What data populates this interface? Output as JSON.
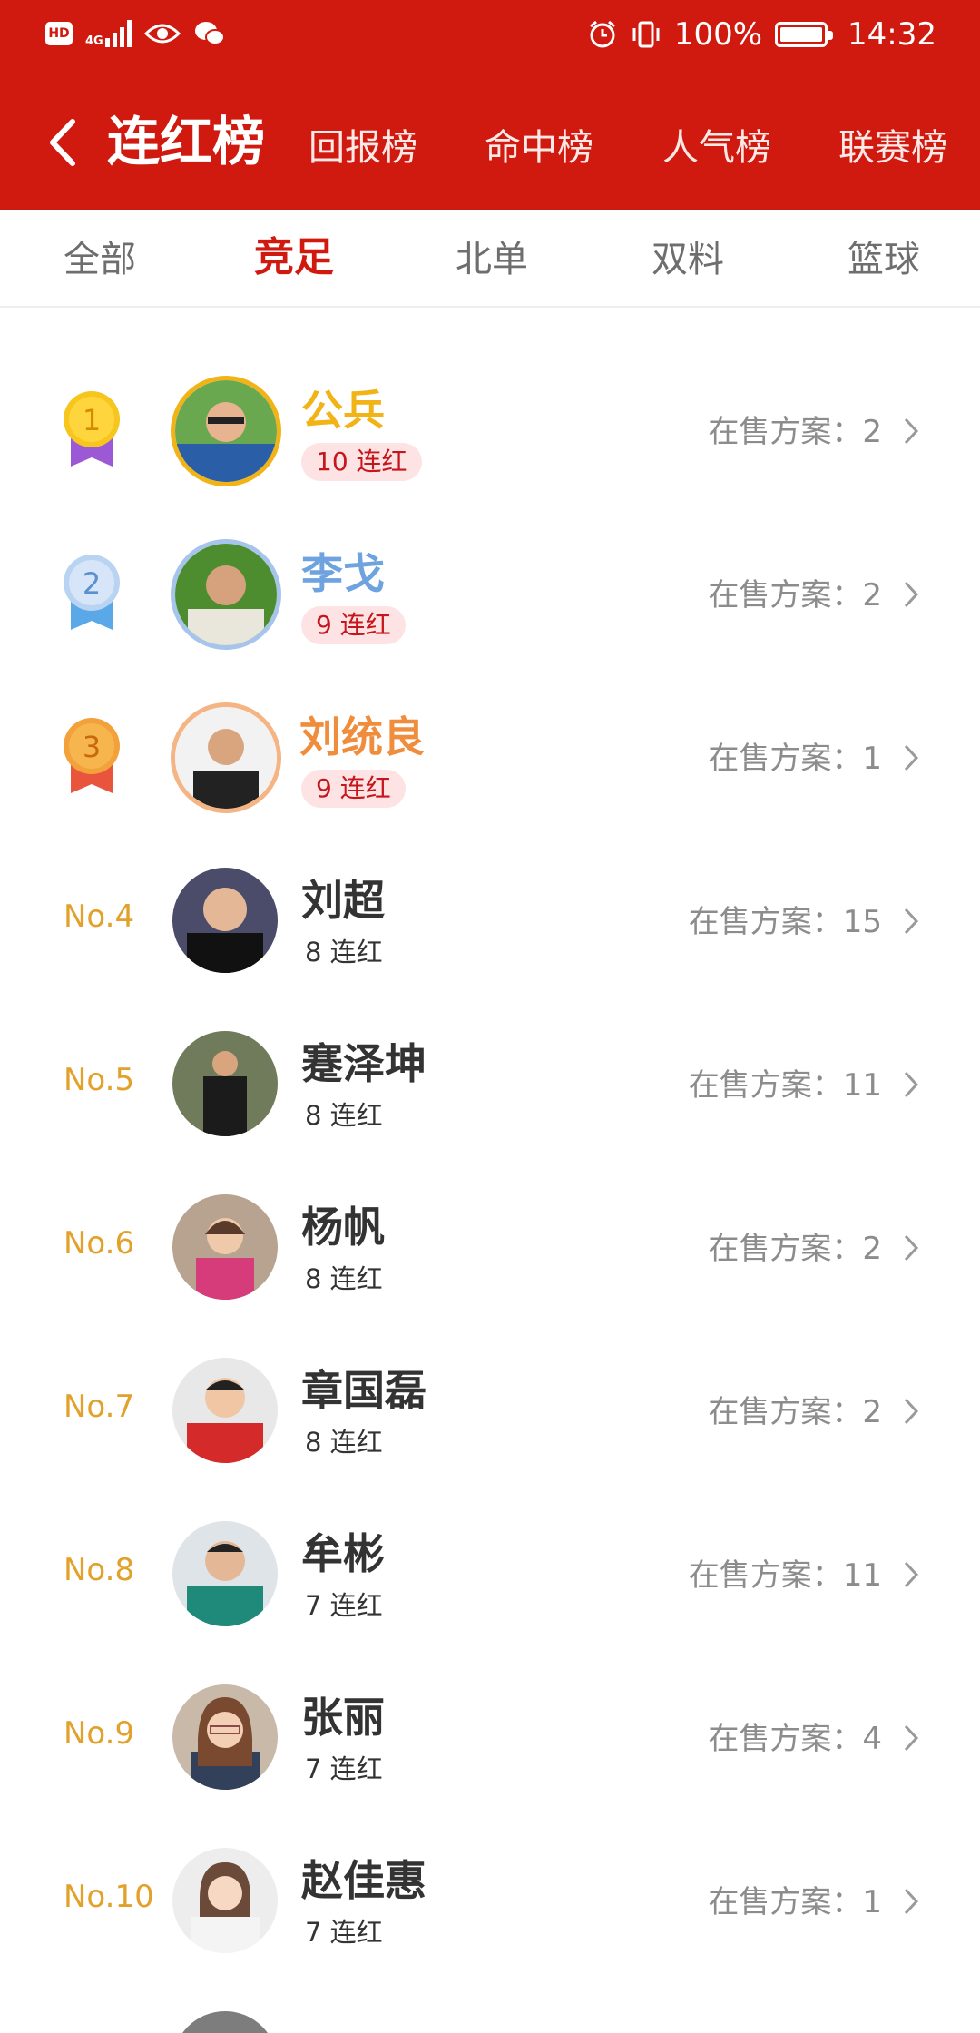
{
  "status_bar": {
    "hd": "HD",
    "network": "4G",
    "battery": "100%",
    "time": "14:32"
  },
  "header": {
    "title": "连红榜",
    "tabs": [
      "回报榜",
      "命中榜",
      "人气榜",
      "联赛榜"
    ]
  },
  "subtabs": [
    "全部",
    "竞足",
    "北单",
    "双料",
    "篮球"
  ],
  "active_subtab": "竞足",
  "colors": {
    "brand_red": "#d0190f",
    "gold": "#f2b317",
    "silver_blue": "#6ea3e0",
    "bronze": "#f08d3c",
    "rank_text": "#e2a12a"
  },
  "ranking": [
    {
      "rank": "1",
      "name": "公兵",
      "streak": "10 连红",
      "onsale_label": "在售方案：",
      "onsale_count": "2"
    },
    {
      "rank": "2",
      "name": "李戈",
      "streak": "9 连红",
      "onsale_label": "在售方案：",
      "onsale_count": "2"
    },
    {
      "rank": "3",
      "name": "刘统良",
      "streak": "9 连红",
      "onsale_label": "在售方案：",
      "onsale_count": "1"
    },
    {
      "rank": "No.4",
      "name": "刘超",
      "streak": "8 连红",
      "onsale_label": "在售方案：",
      "onsale_count": "15"
    },
    {
      "rank": "No.5",
      "name": "蹇泽坤",
      "streak": "8 连红",
      "onsale_label": "在售方案：",
      "onsale_count": "11"
    },
    {
      "rank": "No.6",
      "name": "杨帆",
      "streak": "8 连红",
      "onsale_label": "在售方案：",
      "onsale_count": "2"
    },
    {
      "rank": "No.7",
      "name": "章国磊",
      "streak": "8 连红",
      "onsale_label": "在售方案：",
      "onsale_count": "2"
    },
    {
      "rank": "No.8",
      "name": "牟彬",
      "streak": "7 连红",
      "onsale_label": "在售方案：",
      "onsale_count": "11"
    },
    {
      "rank": "No.9",
      "name": "张丽",
      "streak": "7 连红",
      "onsale_label": "在售方案：",
      "onsale_count": "4"
    },
    {
      "rank": "No.10",
      "name": "赵佳惠",
      "streak": "7 连红",
      "onsale_label": "在售方案：",
      "onsale_count": "1"
    }
  ]
}
